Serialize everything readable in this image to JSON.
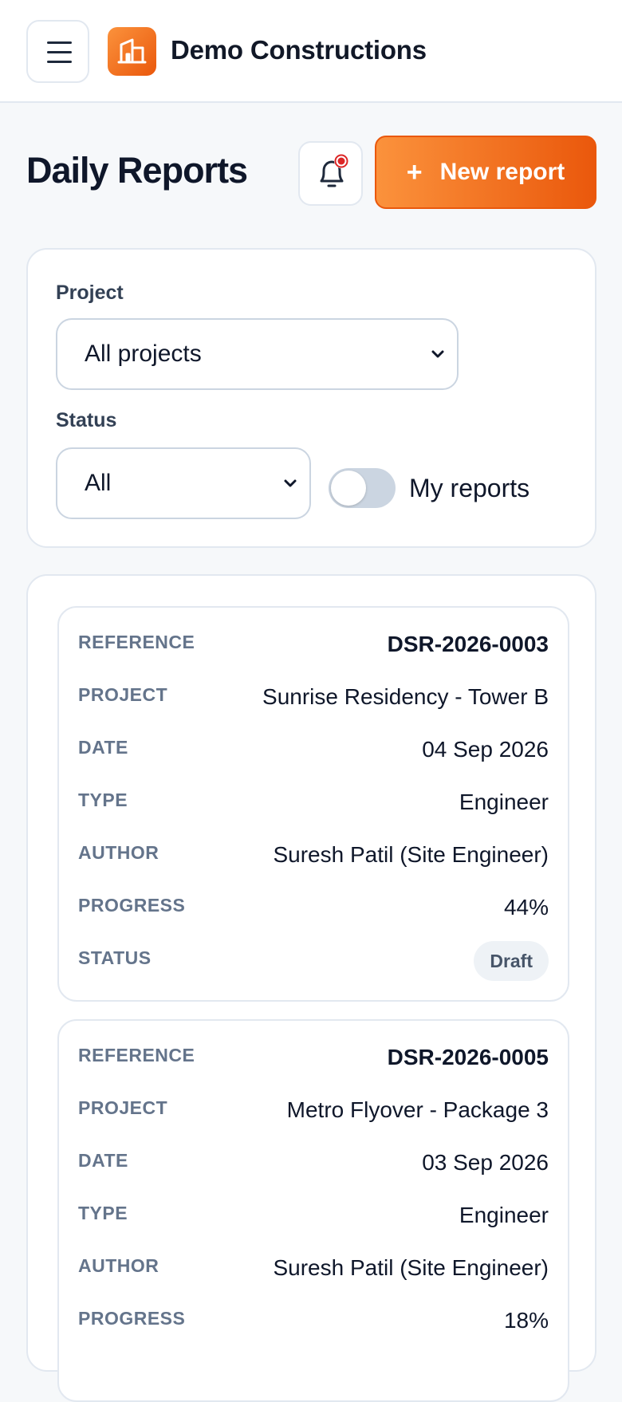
{
  "header": {
    "brand": "Demo Constructions",
    "menu_icon": "menu-icon",
    "logo_icon": "building-icon"
  },
  "page": {
    "title": "Daily Reports",
    "bell_icon": "bell-icon",
    "new_report_label": "New report",
    "new_report_icon": "plus-icon"
  },
  "filters": {
    "project_label": "Project",
    "project_value": "All projects",
    "status_label": "Status",
    "status_value": "All",
    "my_reports_label": "My reports",
    "my_reports_on": false
  },
  "field_labels": {
    "reference": "REFERENCE",
    "project": "PROJECT",
    "date": "DATE",
    "type": "TYPE",
    "author": "AUTHOR",
    "progress": "PROGRESS",
    "status": "STATUS"
  },
  "reports": [
    {
      "reference": "DSR-2026-0003",
      "project": "Sunrise Residency - Tower B",
      "date": "04 Sep 2026",
      "type": "Engineer",
      "author": "Suresh Patil (Site Engineer)",
      "progress": "44%",
      "status": "Draft"
    },
    {
      "reference": "DSR-2026-0005",
      "project": "Metro Flyover - Package 3",
      "date": "03 Sep 2026",
      "type": "Engineer",
      "author": "Suresh Patil (Site Engineer)",
      "progress": "18%"
    }
  ],
  "colors": {
    "accent": "#f97316",
    "accent_dark": "#ea580c",
    "notification_dot": "#dc2626"
  }
}
